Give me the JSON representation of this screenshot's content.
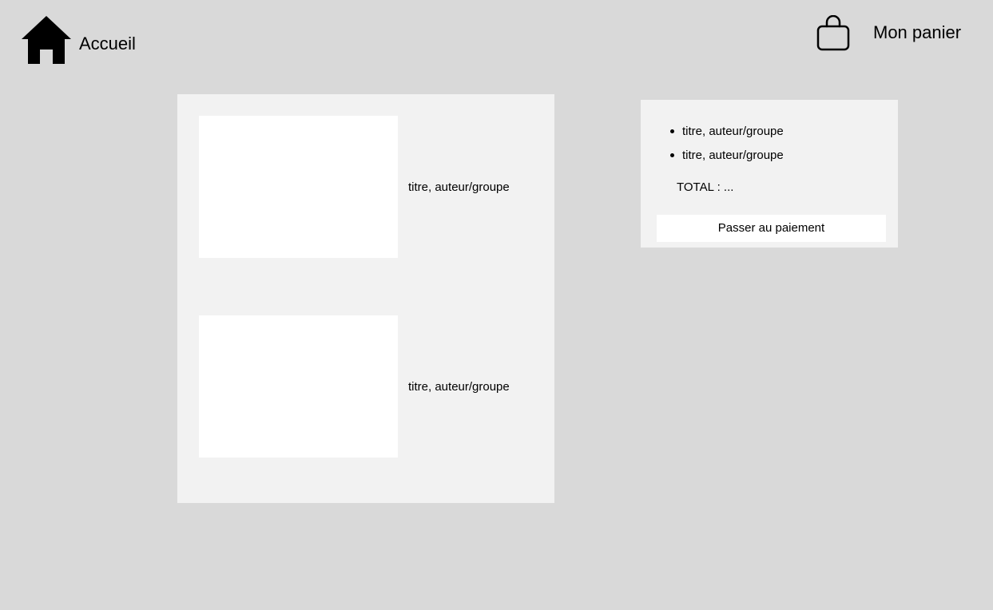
{
  "header": {
    "home_label": "Accueil",
    "home_icon": "home-icon",
    "cart_label": "Mon panier",
    "cart_icon": "shopping-bag-icon"
  },
  "products": [
    {
      "title": "titre, auteur/groupe"
    },
    {
      "title": "titre, auteur/groupe"
    }
  ],
  "cart": {
    "items": [
      {
        "label": "titre, auteur/groupe"
      },
      {
        "label": "titre, auteur/groupe"
      }
    ],
    "total_label": "TOTAL :  ...",
    "pay_button_label": "Passer au paiement"
  },
  "colors": {
    "page_background": "#d9d9d9",
    "panel_background": "#f2f2f2",
    "image_placeholder": "#ffffff"
  }
}
